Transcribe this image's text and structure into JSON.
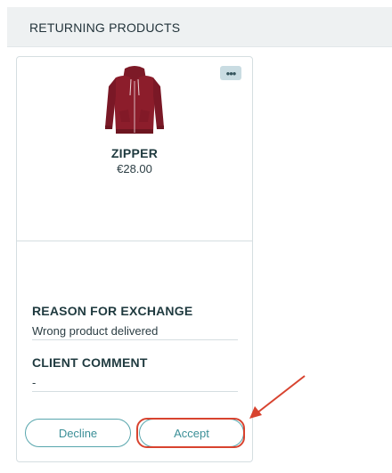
{
  "panel": {
    "title": "RETURNING PRODUCTS"
  },
  "product": {
    "name": "ZIPPER",
    "price": "€28.00",
    "more_label": "•••"
  },
  "details": {
    "reason_label": "REASON FOR EXCHANGE",
    "reason_value": "Wrong product delivered",
    "comment_label": "CLIENT COMMENT",
    "comment_value": "-"
  },
  "actions": {
    "decline_label": "Decline",
    "accept_label": "Accept"
  },
  "colors": {
    "accent": "#3b8f97",
    "annotation": "#d8432f",
    "product": "#8c1d2b"
  }
}
